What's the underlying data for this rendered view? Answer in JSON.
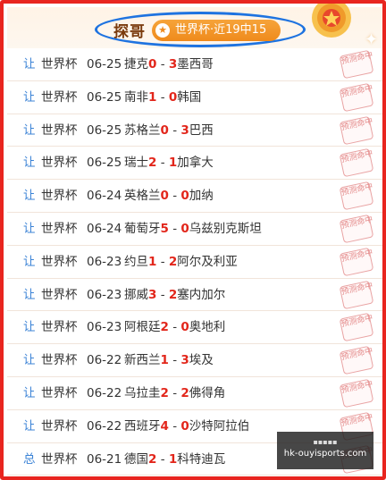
{
  "header": {
    "title": "探哥",
    "badge_text": "世界杯·近19中15",
    "badge_icon": "star-icon"
  },
  "colors": {
    "frame": "#e8251f",
    "highlight_ellipse": "#1e73e0",
    "score": "#e2261b",
    "tag": "#3b83d6",
    "badge": "#ef8a1c"
  },
  "matches": [
    {
      "tag": "让",
      "league": "世界杯",
      "date": "06-25",
      "home": "捷克",
      "hs": "0",
      "sep": " - ",
      "as": "3",
      "away": "墨西哥",
      "stamp": "预测命中"
    },
    {
      "tag": "让",
      "league": "世界杯",
      "date": "06-25",
      "home": "南非",
      "hs": "1",
      "sep": " - ",
      "as": "0",
      "away": "韩国",
      "stamp": "预测命中"
    },
    {
      "tag": "让",
      "league": "世界杯",
      "date": "06-25",
      "home": "苏格兰",
      "hs": "0",
      "sep": " - ",
      "as": "3",
      "away": "巴西",
      "stamp": "预测命中"
    },
    {
      "tag": "让",
      "league": "世界杯",
      "date": "06-25",
      "home": "瑞士",
      "hs": "2",
      "sep": " - ",
      "as": "1",
      "away": "加拿大",
      "stamp": "预测命中"
    },
    {
      "tag": "让",
      "league": "世界杯",
      "date": "06-24",
      "home": "英格兰",
      "hs": "0",
      "sep": " - ",
      "as": "0",
      "away": "加纳",
      "stamp": "预测命中"
    },
    {
      "tag": "让",
      "league": "世界杯",
      "date": "06-24",
      "home": "葡萄牙",
      "hs": "5",
      "sep": " - ",
      "as": "0",
      "away": "乌兹别克斯坦",
      "stamp": "预测命中"
    },
    {
      "tag": "让",
      "league": "世界杯",
      "date": "06-23",
      "home": "约旦",
      "hs": "1",
      "sep": " - ",
      "as": "2",
      "away": "阿尔及利亚",
      "stamp": "预测命中"
    },
    {
      "tag": "让",
      "league": "世界杯",
      "date": "06-23",
      "home": "挪威",
      "hs": "3",
      "sep": " - ",
      "as": "2",
      "away": "塞内加尔",
      "stamp": "预测命中"
    },
    {
      "tag": "让",
      "league": "世界杯",
      "date": "06-23",
      "home": "阿根廷",
      "hs": "2",
      "sep": " - ",
      "as": "0",
      "away": "奥地利",
      "stamp": "预测命中"
    },
    {
      "tag": "让",
      "league": "世界杯",
      "date": "06-22",
      "home": "新西兰",
      "hs": "1",
      "sep": " - ",
      "as": "3",
      "away": "埃及",
      "stamp": "预测命中"
    },
    {
      "tag": "让",
      "league": "世界杯",
      "date": "06-22",
      "home": "乌拉圭",
      "hs": "2",
      "sep": " - ",
      "as": "2",
      "away": "佛得角",
      "stamp": "预测命中"
    },
    {
      "tag": "让",
      "league": "世界杯",
      "date": "06-22",
      "home": "西班牙",
      "hs": "4",
      "sep": " - ",
      "as": "0",
      "away": "沙特阿拉伯",
      "stamp": "预测命中"
    },
    {
      "tag": "总",
      "league": "世界杯",
      "date": "06-21",
      "home": "德国",
      "hs": "2",
      "sep": " - ",
      "as": "1",
      "away": "科特迪瓦",
      "stamp": "预测命中"
    }
  ],
  "watermark": {
    "top": "▪▪▪▪▪",
    "main": "hk-ouyisports.com"
  }
}
